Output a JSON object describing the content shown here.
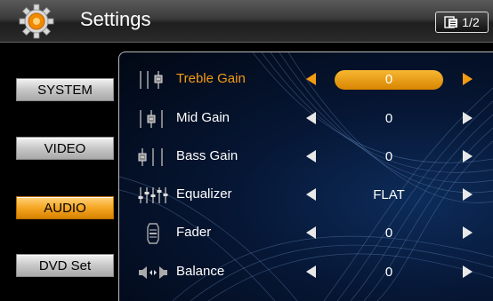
{
  "header": {
    "title": "Settings",
    "page_indicator": "1/2"
  },
  "sidebar": {
    "items": [
      {
        "label": "SYSTEM",
        "active": false
      },
      {
        "label": "VIDEO",
        "active": false
      },
      {
        "label": "AUDIO",
        "active": true
      },
      {
        "label": "DVD Set",
        "active": false
      }
    ]
  },
  "settings": [
    {
      "label": "Treble Gain",
      "value": "0",
      "icon": "treble-icon",
      "selected": true
    },
    {
      "label": "Mid Gain",
      "value": "0",
      "icon": "mid-icon",
      "selected": false
    },
    {
      "label": "Bass Gain",
      "value": "0",
      "icon": "bass-icon",
      "selected": false
    },
    {
      "label": "Equalizer",
      "value": "FLAT",
      "icon": "equalizer-icon",
      "selected": false
    },
    {
      "label": "Fader",
      "value": "0",
      "icon": "fader-icon",
      "selected": false
    },
    {
      "label": "Balance",
      "value": "0",
      "icon": "balance-icon",
      "selected": false
    }
  ],
  "colors": {
    "accent": "#f39c12",
    "panel": "#061634",
    "header": "#3a3a3a"
  }
}
